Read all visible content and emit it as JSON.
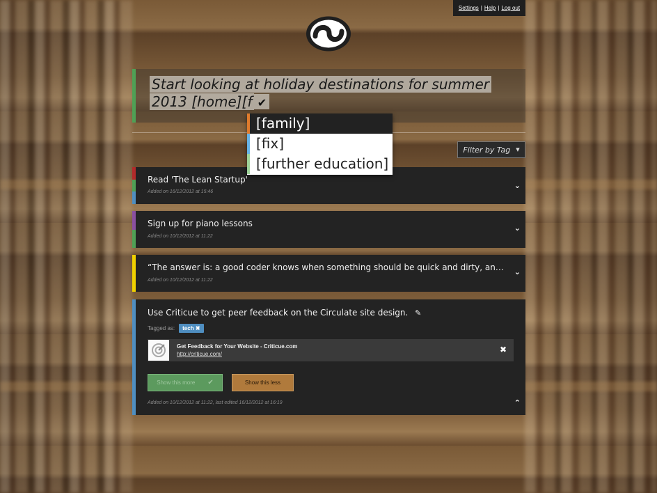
{
  "topbar": {
    "settings": "Settings",
    "sep1": "|",
    "help": "Help",
    "sep2": "|",
    "logout": "Log out"
  },
  "entry": {
    "text": "Start looking at holiday destinations for summer 2013 [home][f",
    "accent": "#4fa055"
  },
  "autocomplete": {
    "options": [
      {
        "label": "[family]",
        "color": "#e07b2c",
        "active": true
      },
      {
        "label": "[fix]",
        "color": "#67b3e6",
        "active": false
      },
      {
        "label": "[further education]",
        "color": "#9fd39a",
        "active": false
      }
    ]
  },
  "filter": {
    "label": "Filter by Tag"
  },
  "tasks": [
    {
      "title": "Read 'The Lean Startup'",
      "meta": "Added on 16/12/2012 at 15:46",
      "stripes": [
        "#b22a2a",
        "#4fa055",
        "#4f8ec0"
      ]
    },
    {
      "title": "Sign up for piano lessons",
      "meta": "Added on 10/12/2012 at 11:22",
      "stripes": [
        "#8a4fa0",
        "#4fa055"
      ]
    },
    {
      "title": "“The answer is: a good coder knows when something should be quick and dirty, and when …",
      "meta": "Added on 10/12/2012 at 11:22",
      "stripes": [
        "#f0d000"
      ]
    },
    {
      "title": "Use Criticue to get peer feedback on the Circulate site design.",
      "tagged_label": "Tagged as:",
      "tag": "tech",
      "link_title": "Get Feedback for Your Website - Criticue.com",
      "link_url": "http://criticue.com/",
      "show_more": "Show this more",
      "show_less": "Show this less",
      "meta": "Added on 10/12/2012 at 11:22, last edited 16/12/2012 at 16:19",
      "stripes": [
        "#4f8ec0"
      ]
    }
  ]
}
